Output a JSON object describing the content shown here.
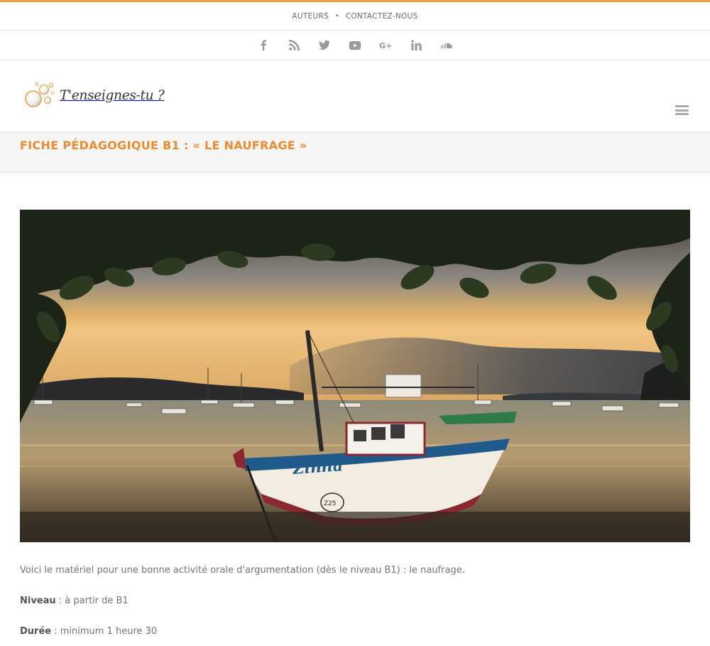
{
  "top_nav": {
    "items": [
      "AUTEURS",
      "CONTACTEZ-NOUS"
    ],
    "separator": "•"
  },
  "social_icons": [
    "facebook-icon",
    "rss-icon",
    "twitter-icon",
    "youtube-icon",
    "google-plus-icon",
    "linkedin-icon",
    "soundcloud-icon"
  ],
  "logo": {
    "text": "T'enseignes-tu ?"
  },
  "page": {
    "title": "FICHE PÉDAGOGIQUE B1 : « LE NAUFRAGE »"
  },
  "hero_image": {
    "boat_name": "Zinha",
    "boat_number": "Z25"
  },
  "content": {
    "intro": "Voici le matériel pour une bonne activité orale d'argumentation (dès le niveau B1) : le naufrage.",
    "niveau_label": "Niveau",
    "niveau_value": " : à partir de B1",
    "duree_label": "Durée",
    "duree_value": " : minimum 1 heure 30"
  },
  "colors": {
    "accent": "#ef8a2d",
    "top_line": "#e8a33a",
    "text": "#747474"
  }
}
